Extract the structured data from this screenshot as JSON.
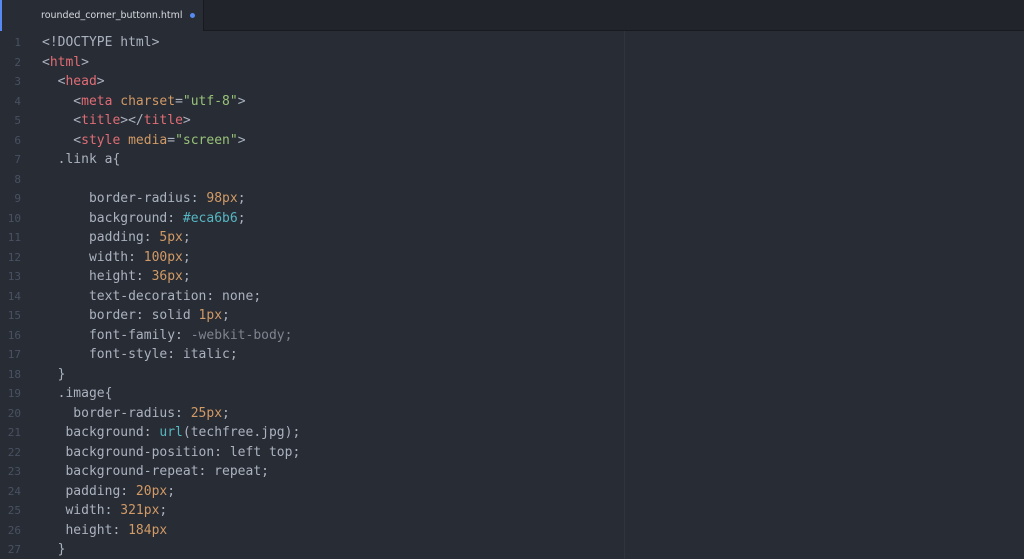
{
  "tab": {
    "title": "rounded_corner_buttonn.html",
    "modified_icon": "modified-dot-icon"
  },
  "line_numbers": [
    "1",
    "2",
    "3",
    "4",
    "5",
    "6",
    "7",
    "8",
    "9",
    "10",
    "11",
    "12",
    "13",
    "14",
    "15",
    "16",
    "17",
    "18",
    "19",
    "20",
    "21",
    "22",
    "23",
    "24",
    "25",
    "26",
    "27"
  ],
  "code_lines": [
    [
      {
        "t": "<!DOCTYPE html>",
        "c": "t-punc"
      }
    ],
    [
      {
        "t": "<",
        "c": "t-punc"
      },
      {
        "t": "html",
        "c": "t-tag"
      },
      {
        "t": ">",
        "c": "t-punc"
      }
    ],
    [
      {
        "t": "  <",
        "c": "t-punc"
      },
      {
        "t": "head",
        "c": "t-tag"
      },
      {
        "t": ">",
        "c": "t-punc"
      }
    ],
    [
      {
        "t": "    <",
        "c": "t-punc"
      },
      {
        "t": "meta ",
        "c": "t-tag"
      },
      {
        "t": "charset",
        "c": "t-attr"
      },
      {
        "t": "=",
        "c": "t-punc"
      },
      {
        "t": "\"utf-8\"",
        "c": "t-str"
      },
      {
        "t": ">",
        "c": "t-punc"
      }
    ],
    [
      {
        "t": "    <",
        "c": "t-punc"
      },
      {
        "t": "title",
        "c": "t-tag"
      },
      {
        "t": "></",
        "c": "t-punc"
      },
      {
        "t": "title",
        "c": "t-tag"
      },
      {
        "t": ">",
        "c": "t-punc"
      }
    ],
    [
      {
        "t": "    <",
        "c": "t-punc"
      },
      {
        "t": "style ",
        "c": "t-tag"
      },
      {
        "t": "media",
        "c": "t-attr"
      },
      {
        "t": "=",
        "c": "t-punc"
      },
      {
        "t": "\"screen\"",
        "c": "t-str"
      },
      {
        "t": ">",
        "c": "t-punc"
      }
    ],
    [
      {
        "t": "  .link a{",
        "c": "t-punc"
      }
    ],
    [
      {
        "t": "",
        "c": "t-punc"
      }
    ],
    [
      {
        "t": "      border-radius: ",
        "c": "t-prop"
      },
      {
        "t": "98px",
        "c": "t-num"
      },
      {
        "t": ";",
        "c": "t-punc"
      }
    ],
    [
      {
        "t": "      background: ",
        "c": "t-prop"
      },
      {
        "t": "#eca6b6",
        "c": "t-hex"
      },
      {
        "t": ";",
        "c": "t-punc"
      }
    ],
    [
      {
        "t": "      padding: ",
        "c": "t-prop"
      },
      {
        "t": "5px",
        "c": "t-num"
      },
      {
        "t": ";",
        "c": "t-punc"
      }
    ],
    [
      {
        "t": "      width: ",
        "c": "t-prop"
      },
      {
        "t": "100px",
        "c": "t-num"
      },
      {
        "t": ";",
        "c": "t-punc"
      }
    ],
    [
      {
        "t": "      height: ",
        "c": "t-prop"
      },
      {
        "t": "36px",
        "c": "t-num"
      },
      {
        "t": ";",
        "c": "t-punc"
      }
    ],
    [
      {
        "t": "      text-decoration: none;",
        "c": "t-prop"
      }
    ],
    [
      {
        "t": "      border: solid ",
        "c": "t-prop"
      },
      {
        "t": "1px",
        "c": "t-num"
      },
      {
        "t": ";",
        "c": "t-punc"
      }
    ],
    [
      {
        "t": "      font-family: ",
        "c": "t-prop"
      },
      {
        "t": "-webkit-body;",
        "c": "t-cmt"
      }
    ],
    [
      {
        "t": "      font-style: italic;",
        "c": "t-prop"
      }
    ],
    [
      {
        "t": "  }",
        "c": "t-punc"
      }
    ],
    [
      {
        "t": "  .image{",
        "c": "t-punc"
      }
    ],
    [
      {
        "t": "    border-radius: ",
        "c": "t-prop"
      },
      {
        "t": "25px",
        "c": "t-num"
      },
      {
        "t": ";",
        "c": "t-punc"
      }
    ],
    [
      {
        "t": "   background: ",
        "c": "t-prop"
      },
      {
        "t": "url",
        "c": "t-fn"
      },
      {
        "t": "(techfree.jpg);",
        "c": "t-punc"
      }
    ],
    [
      {
        "t": "   background-position: left top;",
        "c": "t-prop"
      }
    ],
    [
      {
        "t": "   background-repeat: repeat;",
        "c": "t-prop"
      }
    ],
    [
      {
        "t": "   padding: ",
        "c": "t-prop"
      },
      {
        "t": "20px",
        "c": "t-num"
      },
      {
        "t": ";",
        "c": "t-punc"
      }
    ],
    [
      {
        "t": "   width: ",
        "c": "t-prop"
      },
      {
        "t": "321px",
        "c": "t-num"
      },
      {
        "t": ";",
        "c": "t-punc"
      }
    ],
    [
      {
        "t": "   height: ",
        "c": "t-prop"
      },
      {
        "t": "184px",
        "c": "t-num"
      }
    ],
    [
      {
        "t": "  }",
        "c": "t-punc"
      }
    ]
  ]
}
